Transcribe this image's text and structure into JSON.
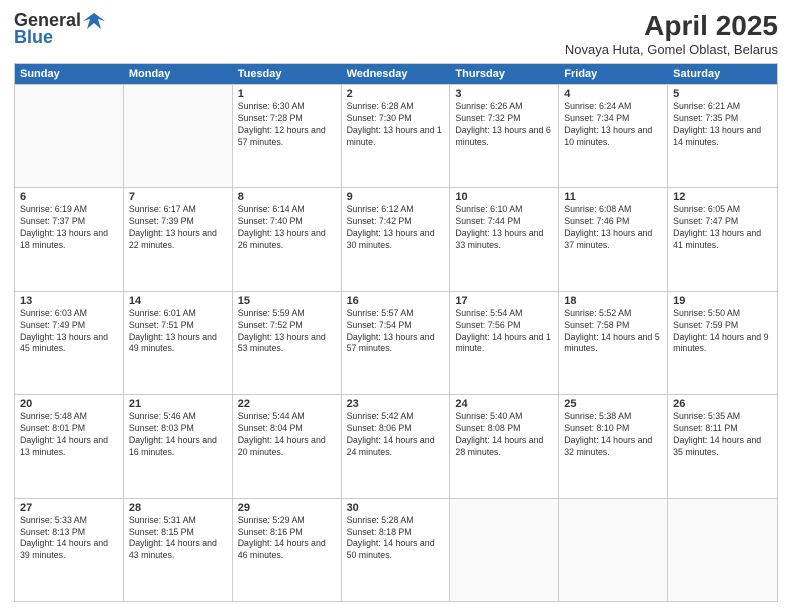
{
  "header": {
    "logo_general": "General",
    "logo_blue": "Blue",
    "title": "April 2025",
    "subtitle": "Novaya Huta, Gomel Oblast, Belarus"
  },
  "days": [
    "Sunday",
    "Monday",
    "Tuesday",
    "Wednesday",
    "Thursday",
    "Friday",
    "Saturday"
  ],
  "weeks": [
    [
      {
        "day": "",
        "detail": ""
      },
      {
        "day": "",
        "detail": ""
      },
      {
        "day": "1",
        "detail": "Sunrise: 6:30 AM\nSunset: 7:28 PM\nDaylight: 12 hours and 57 minutes."
      },
      {
        "day": "2",
        "detail": "Sunrise: 6:28 AM\nSunset: 7:30 PM\nDaylight: 13 hours and 1 minute."
      },
      {
        "day": "3",
        "detail": "Sunrise: 6:26 AM\nSunset: 7:32 PM\nDaylight: 13 hours and 6 minutes."
      },
      {
        "day": "4",
        "detail": "Sunrise: 6:24 AM\nSunset: 7:34 PM\nDaylight: 13 hours and 10 minutes."
      },
      {
        "day": "5",
        "detail": "Sunrise: 6:21 AM\nSunset: 7:35 PM\nDaylight: 13 hours and 14 minutes."
      }
    ],
    [
      {
        "day": "6",
        "detail": "Sunrise: 6:19 AM\nSunset: 7:37 PM\nDaylight: 13 hours and 18 minutes."
      },
      {
        "day": "7",
        "detail": "Sunrise: 6:17 AM\nSunset: 7:39 PM\nDaylight: 13 hours and 22 minutes."
      },
      {
        "day": "8",
        "detail": "Sunrise: 6:14 AM\nSunset: 7:40 PM\nDaylight: 13 hours and 26 minutes."
      },
      {
        "day": "9",
        "detail": "Sunrise: 6:12 AM\nSunset: 7:42 PM\nDaylight: 13 hours and 30 minutes."
      },
      {
        "day": "10",
        "detail": "Sunrise: 6:10 AM\nSunset: 7:44 PM\nDaylight: 13 hours and 33 minutes."
      },
      {
        "day": "11",
        "detail": "Sunrise: 6:08 AM\nSunset: 7:46 PM\nDaylight: 13 hours and 37 minutes."
      },
      {
        "day": "12",
        "detail": "Sunrise: 6:05 AM\nSunset: 7:47 PM\nDaylight: 13 hours and 41 minutes."
      }
    ],
    [
      {
        "day": "13",
        "detail": "Sunrise: 6:03 AM\nSunset: 7:49 PM\nDaylight: 13 hours and 45 minutes."
      },
      {
        "day": "14",
        "detail": "Sunrise: 6:01 AM\nSunset: 7:51 PM\nDaylight: 13 hours and 49 minutes."
      },
      {
        "day": "15",
        "detail": "Sunrise: 5:59 AM\nSunset: 7:52 PM\nDaylight: 13 hours and 53 minutes."
      },
      {
        "day": "16",
        "detail": "Sunrise: 5:57 AM\nSunset: 7:54 PM\nDaylight: 13 hours and 57 minutes."
      },
      {
        "day": "17",
        "detail": "Sunrise: 5:54 AM\nSunset: 7:56 PM\nDaylight: 14 hours and 1 minute."
      },
      {
        "day": "18",
        "detail": "Sunrise: 5:52 AM\nSunset: 7:58 PM\nDaylight: 14 hours and 5 minutes."
      },
      {
        "day": "19",
        "detail": "Sunrise: 5:50 AM\nSunset: 7:59 PM\nDaylight: 14 hours and 9 minutes."
      }
    ],
    [
      {
        "day": "20",
        "detail": "Sunrise: 5:48 AM\nSunset: 8:01 PM\nDaylight: 14 hours and 13 minutes."
      },
      {
        "day": "21",
        "detail": "Sunrise: 5:46 AM\nSunset: 8:03 PM\nDaylight: 14 hours and 16 minutes."
      },
      {
        "day": "22",
        "detail": "Sunrise: 5:44 AM\nSunset: 8:04 PM\nDaylight: 14 hours and 20 minutes."
      },
      {
        "day": "23",
        "detail": "Sunrise: 5:42 AM\nSunset: 8:06 PM\nDaylight: 14 hours and 24 minutes."
      },
      {
        "day": "24",
        "detail": "Sunrise: 5:40 AM\nSunset: 8:08 PM\nDaylight: 14 hours and 28 minutes."
      },
      {
        "day": "25",
        "detail": "Sunrise: 5:38 AM\nSunset: 8:10 PM\nDaylight: 14 hours and 32 minutes."
      },
      {
        "day": "26",
        "detail": "Sunrise: 5:35 AM\nSunset: 8:11 PM\nDaylight: 14 hours and 35 minutes."
      }
    ],
    [
      {
        "day": "27",
        "detail": "Sunrise: 5:33 AM\nSunset: 8:13 PM\nDaylight: 14 hours and 39 minutes."
      },
      {
        "day": "28",
        "detail": "Sunrise: 5:31 AM\nSunset: 8:15 PM\nDaylight: 14 hours and 43 minutes."
      },
      {
        "day": "29",
        "detail": "Sunrise: 5:29 AM\nSunset: 8:16 PM\nDaylight: 14 hours and 46 minutes."
      },
      {
        "day": "30",
        "detail": "Sunrise: 5:28 AM\nSunset: 8:18 PM\nDaylight: 14 hours and 50 minutes."
      },
      {
        "day": "",
        "detail": ""
      },
      {
        "day": "",
        "detail": ""
      },
      {
        "day": "",
        "detail": ""
      }
    ]
  ]
}
